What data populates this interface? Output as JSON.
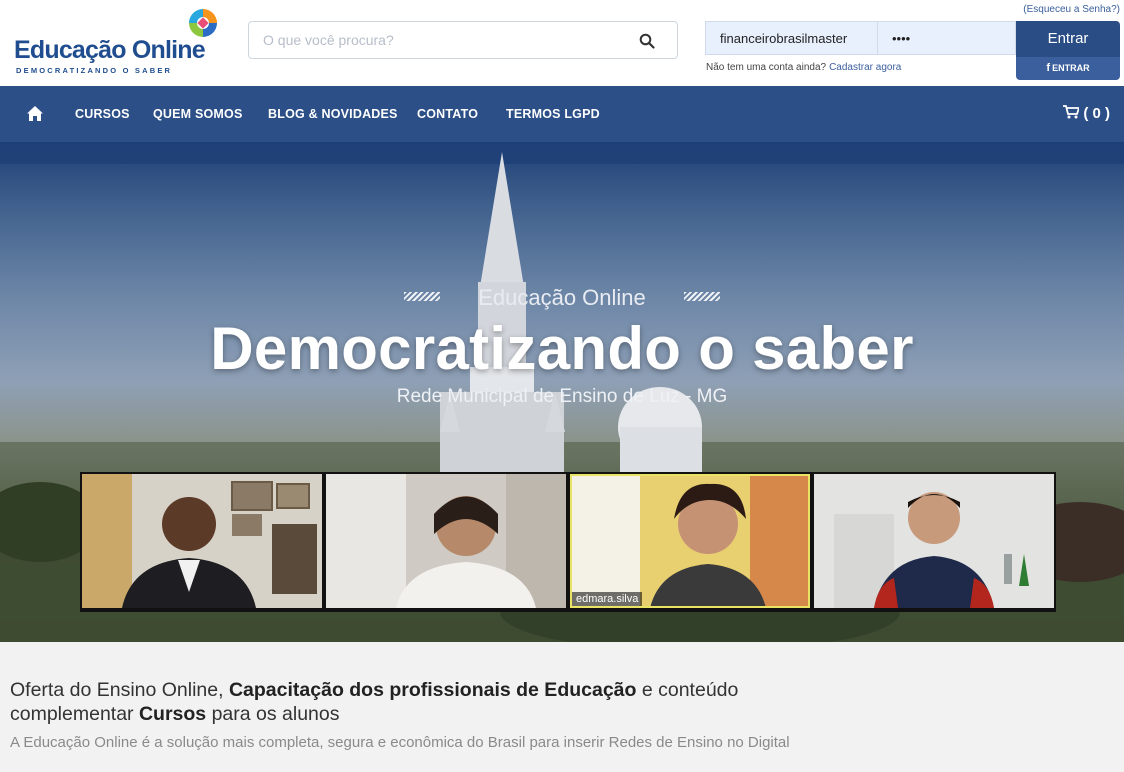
{
  "header": {
    "logo_text": "Educação Online",
    "logo_tagline": "DEMOCRATIZANDO O SABER",
    "search_placeholder": "O que você procura?",
    "forgot_link": "(Esqueceu a Senha?)",
    "username_value": "financeirobrasilmaster",
    "password_value": "••••",
    "login_button": "Entrar",
    "facebook_button": "ENTRAR",
    "no_account_text": "Não tem uma conta ainda?",
    "register_link": "Cadastrar agora"
  },
  "nav": {
    "items": [
      {
        "label": "CURSOS"
      },
      {
        "label": "QUEM SOMOS"
      },
      {
        "label": "BLOG & NOVIDADES"
      },
      {
        "label": "CONTATO"
      },
      {
        "label": "TERMOS LGPD"
      }
    ],
    "cart_label": "( 0 )"
  },
  "hero": {
    "kicker": "Educação Online",
    "title": "Democratizando o saber",
    "subtitle": "Rede Municipal de Ensino de Luz - MG",
    "video_tiles": [
      {
        "name": ""
      },
      {
        "name": ""
      },
      {
        "name": "edmara.silva"
      },
      {
        "name": ""
      }
    ]
  },
  "intro": {
    "headline_part1": "Oferta do Ensino Online, ",
    "headline_bold1": "Capacitação dos profissionais de Educação",
    "headline_part2": " e conteúdo complementar ",
    "headline_bold2": "Cursos",
    "headline_part3": " para os alunos",
    "description": "A Educação Online é a solução mais completa, segura e econômica do Brasil para inserir Redes de Ensino no Digital"
  },
  "colors": {
    "brand_blue": "#2c4f88",
    "dark_blue": "#1f4d8f",
    "link_blue": "#3a5f9c",
    "active_speaker": "#e9e463"
  },
  "icons": {
    "logo": "colorful-ring-logo-icon",
    "search": "search-icon",
    "home": "home-icon",
    "cart": "cart-icon",
    "facebook": "facebook-icon"
  }
}
